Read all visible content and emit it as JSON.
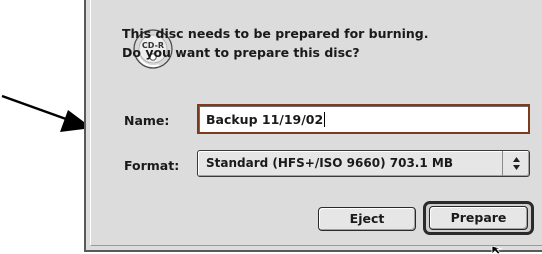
{
  "dialog": {
    "icon": "cd-r-disc-icon",
    "icon_text": "CD-R",
    "message_line1": "This disc needs to be prepared for burning.",
    "message_line2": "Do you want to prepare this disc?"
  },
  "form": {
    "name_label": "Name:",
    "name_value": "Backup 11/19/02",
    "format_label": "Format:",
    "format_value": "Standard (HFS+/ISO 9660) 703.1 MB"
  },
  "buttons": {
    "eject_label": "Eject",
    "prepare_label": "Prepare"
  },
  "colors": {
    "dialog_background": "#dcdcdc",
    "focus_ring": "#7e3a1c"
  }
}
